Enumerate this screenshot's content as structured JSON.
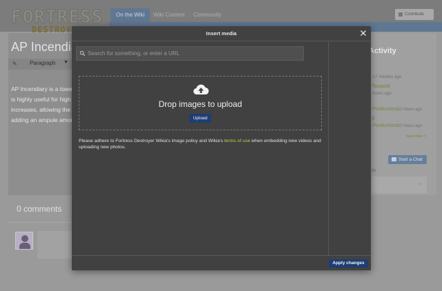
{
  "site": {
    "logo_top": "FORTRESS",
    "logo_bottom": "DESTROYER",
    "nav_tabs": [
      {
        "label": "On the Wiki",
        "active": true
      },
      {
        "label": "Wiki Content",
        "active": false
      },
      {
        "label": "Community",
        "active": false
      }
    ],
    "contribute_label": "Contribute",
    "accent": "#5f7792"
  },
  "article": {
    "title": "AP Incendia",
    "toolbar_paragraph": "Paragraph",
    "text_lines": [
      "AP Incendiary is a towe",
      "is highly useful for high",
      "increases, allowing the",
      "adding an ampule amou"
    ],
    "comments_label": "0 comments"
  },
  "rail": {
    "heading": "Activity",
    "entries": [
      {
        "link": "",
        "time": "17 minutes ago"
      },
      {
        "link": "Taraacid",
        "time": "hours ago"
      },
      {
        "link": "e Productions",
        "time": "12 hours ago"
      },
      {
        "link": "S",
        "time": ""
      },
      {
        "link": "e Productions",
        "time": "12 hours ago"
      }
    ],
    "see_more": "See more >",
    "chat_label": "Start a Chat",
    "section_label": "ta",
    "link_color": "#6d8a3a"
  },
  "modal": {
    "title": "Insert media",
    "close_icon": "close-icon",
    "search_placeholder": "Search for something, or enter a URL",
    "search_icon": "search-icon",
    "upload_icon": "upload-cloud-icon",
    "drop_text": "Drop images to upload",
    "upload_label": "Upload",
    "policy_before": "Please adhere to Fortress Destroyer Wikia's image policy and Wikia's ",
    "policy_link": "terms of use",
    "policy_after": " when embedding new videos and uploading new photos.",
    "apply_label": "Apply changes",
    "button_color": "#1e3d73",
    "link_color": "#b8d44a"
  }
}
